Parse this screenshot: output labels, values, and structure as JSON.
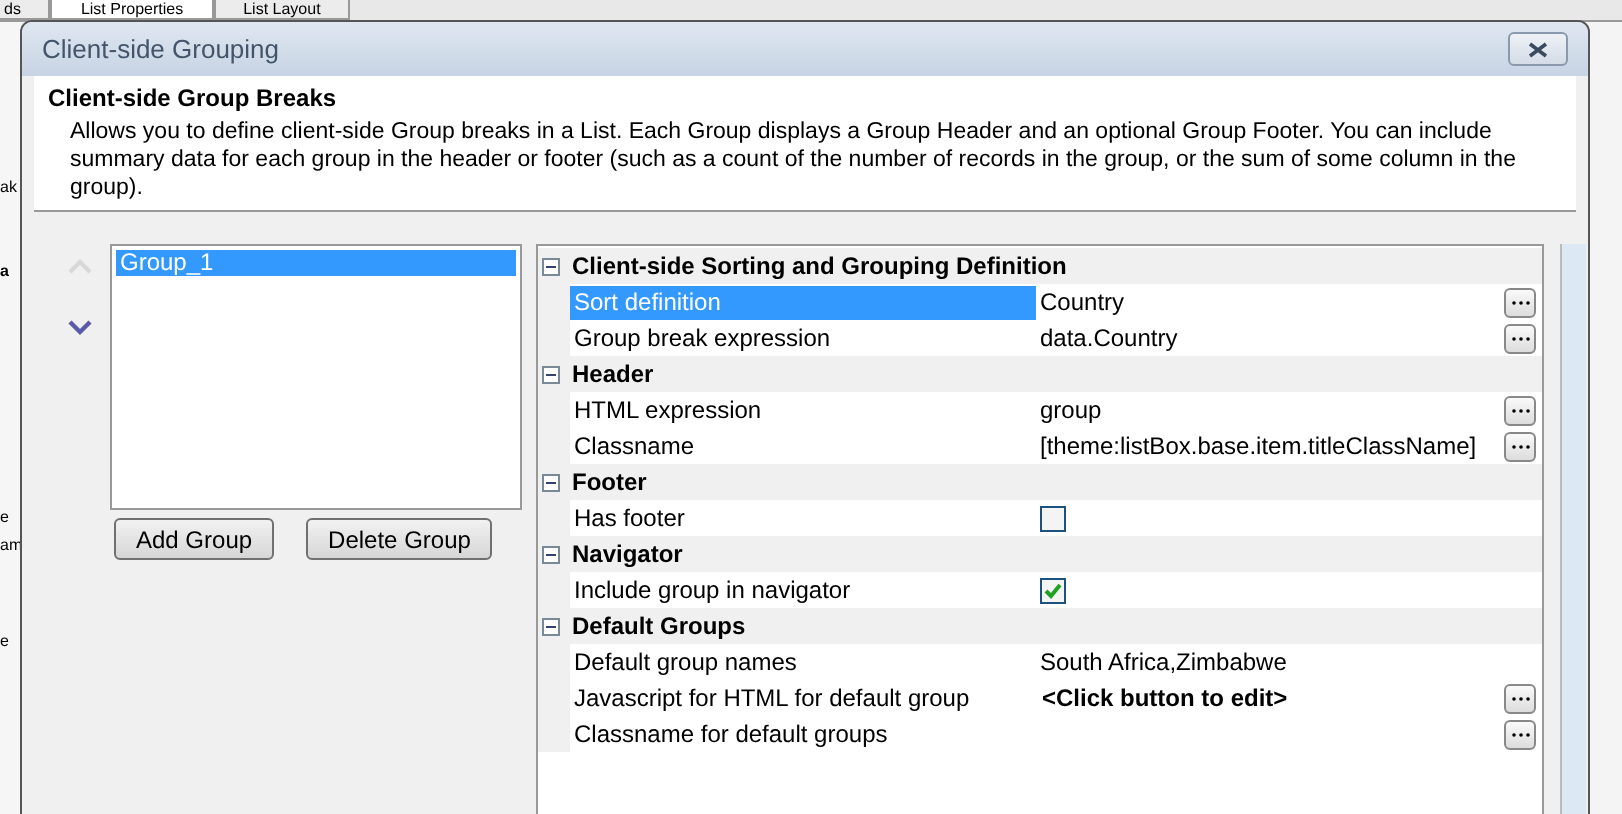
{
  "background_tabs": [
    {
      "label": "ds",
      "selected": false
    },
    {
      "label": "List Properties",
      "selected": true
    },
    {
      "label": "List Layout",
      "selected": false
    }
  ],
  "background_fragments": [
    "ak",
    "a",
    "e",
    "am",
    "e"
  ],
  "window": {
    "title": "Client-side Grouping"
  },
  "header": {
    "title": "Client-side Group Breaks",
    "description": "Allows you to define client-side Group breaks in a List. Each Group displays a Group Header and an optional Group Footer. You can include summary data for each group in the header or footer (such as a count of the number of records in the group, or the sum of some column in the group)."
  },
  "move_buttons": [
    {
      "kind": "up",
      "disabled": true
    },
    {
      "kind": "down",
      "disabled": false
    }
  ],
  "groups": [
    {
      "label": "Group_1",
      "selected": true
    }
  ],
  "group_buttons": [
    "Add Group",
    "Delete Group"
  ],
  "properties": [
    {
      "category": "Client-side Sorting and Grouping Definition",
      "expanded": true,
      "rows": [
        {
          "name": "Sort definition",
          "kind": "text",
          "value": "Country",
          "selected": true,
          "editor_button": true
        },
        {
          "name": "Group break expression",
          "kind": "text",
          "value": "data.Country",
          "selected": false,
          "editor_button": true
        }
      ]
    },
    {
      "category": "Header",
      "expanded": true,
      "rows": [
        {
          "name": "HTML expression",
          "kind": "text",
          "value": "group",
          "selected": false,
          "editor_button": true
        },
        {
          "name": "Classname",
          "kind": "text",
          "value": "[theme:listBox.base.item.titleClassName]",
          "selected": false,
          "editor_button": true
        }
      ]
    },
    {
      "category": "Footer",
      "expanded": true,
      "rows": [
        {
          "name": "Has footer",
          "kind": "checkbox",
          "checked": false,
          "selected": false,
          "editor_button": false
        }
      ]
    },
    {
      "category": "Navigator",
      "expanded": true,
      "rows": [
        {
          "name": "Include group in navigator",
          "kind": "checkbox",
          "checked": true,
          "selected": false,
          "editor_button": false
        }
      ]
    },
    {
      "category": "Default Groups",
      "expanded": true,
      "rows": [
        {
          "name": "Default group names",
          "kind": "text",
          "value": "South Africa,Zimbabwe",
          "selected": false,
          "editor_button": false
        },
        {
          "name": "Javascript for HTML for default group",
          "kind": "prompt",
          "value": "<Click button to edit>",
          "selected": false,
          "editor_button": true
        },
        {
          "name": "Classname for default groups",
          "kind": "empty",
          "selected": false,
          "editor_button": true
        }
      ]
    }
  ]
}
